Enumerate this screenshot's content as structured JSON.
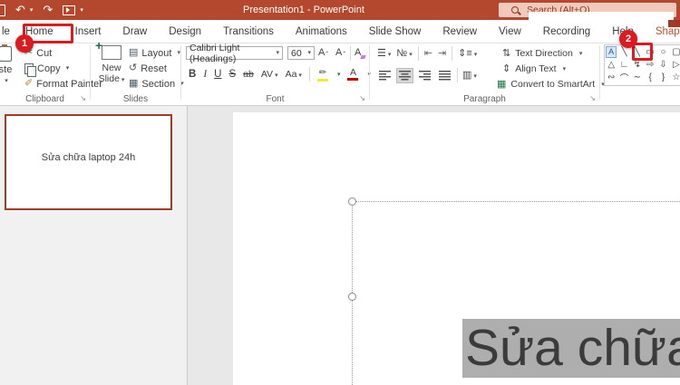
{
  "titlebar": {
    "title": "Presentation1 - PowerPoint",
    "search_placeholder": "Search (Alt+Q)"
  },
  "tabs": [
    "le",
    "Home",
    "Insert",
    "Draw",
    "Design",
    "Transitions",
    "Animations",
    "Slide Show",
    "Review",
    "View",
    "Recording",
    "Help",
    "Shape Format"
  ],
  "annotations": {
    "step1": "1",
    "step2": "2",
    "accent_color": "#dd1a1f"
  },
  "ribbon": {
    "clipboard": {
      "label": "Clipboard",
      "paste_partial": "ste",
      "cut": "Cut",
      "copy": "Copy",
      "format_painter": "Format Painter"
    },
    "slides": {
      "label": "Slides",
      "new_slide_line1": "New",
      "new_slide_line2": "Slide",
      "layout": "Layout",
      "reset": "Reset",
      "section": "Section"
    },
    "font": {
      "label": "Font",
      "name": "Calibri Light (Headings)",
      "size": "60",
      "bold": "B",
      "italic": "I",
      "underline": "U",
      "strikethrough": "S",
      "strike_ab": "ab",
      "char_spacing": "AV",
      "change_case": "Aa",
      "grow": "A",
      "shrink": "A",
      "clear": "A",
      "color": "A",
      "highlight_bar": "#f3e73c",
      "color_bar": "#c00000"
    },
    "paragraph": {
      "label": "Paragraph",
      "text_direction": "Text Direction",
      "align_text": "Align Text",
      "smartart": "Convert to SmartArt"
    },
    "drawing": {
      "shapes": [
        [
          "A",
          "╲",
          "╲",
          "▭",
          "○",
          "▢"
        ],
        [
          "△",
          "∟",
          "↯",
          "⇨",
          "⇩",
          "▷"
        ],
        [
          "∾",
          "⌒",
          "∼",
          "{",
          "}",
          "☆"
        ]
      ]
    }
  },
  "icons": {
    "dropdown": "▾",
    "undo": "↶",
    "redo": "↷",
    "cut": "✂",
    "format_painter": "✐",
    "layout": "▤",
    "reset": "↺",
    "section": "▦",
    "caret_up": "ˆ",
    "caret_down": "ˇ",
    "bullets": "☰",
    "numbering": "№",
    "indent_decrease": "⇤",
    "indent_increase": "⇥",
    "line_spacing": "⇕≡",
    "columns": "▥",
    "text_direction": "⇅",
    "align_text": "⇕",
    "smartart": "▦",
    "highlight_pen": "✏",
    "dialog_launcher": "↘"
  },
  "slide_panel": {
    "thumbnail_text": "Sửa chữa laptop 24h"
  },
  "canvas": {
    "selected_text": "Sửa chữa"
  },
  "colors": {
    "titlebar": "#b4482e",
    "search_pill": "#f2cabb",
    "thumbnail_border": "#a23c28",
    "selection_highlight": "#aeaeae",
    "active_tab_text": "#bf4e2e",
    "workspace": "#e8e8e8"
  }
}
